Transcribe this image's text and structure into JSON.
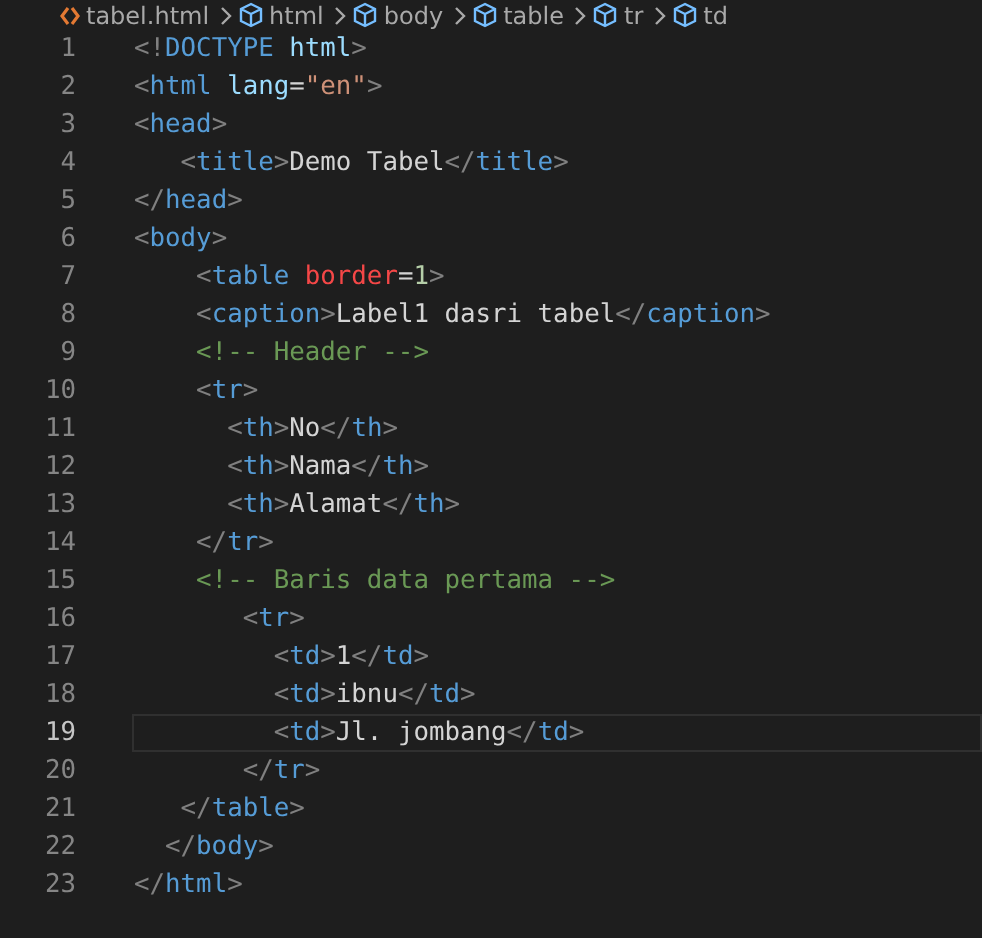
{
  "breadcrumb": [
    {
      "kind": "file",
      "label": "tabel.html"
    },
    {
      "kind": "element",
      "label": "html"
    },
    {
      "kind": "element",
      "label": "body"
    },
    {
      "kind": "element",
      "label": "table"
    },
    {
      "kind": "element",
      "label": "tr"
    },
    {
      "kind": "element",
      "label": "td"
    }
  ],
  "lines": [
    {
      "number": "1",
      "active": false,
      "tokens": [
        {
          "kind": "punct",
          "text": "<!"
        },
        {
          "kind": "tag",
          "text": "DOCTYPE"
        },
        {
          "kind": "attr",
          "text": " html"
        },
        {
          "kind": "punct",
          "text": ">"
        }
      ]
    },
    {
      "number": "2",
      "active": false,
      "tokens": [
        {
          "kind": "punct",
          "text": "<"
        },
        {
          "kind": "tag",
          "text": "html"
        },
        {
          "kind": "attr",
          "text": " lang"
        },
        {
          "kind": "text",
          "text": "="
        },
        {
          "kind": "string",
          "text": "\"en\""
        },
        {
          "kind": "punct",
          "text": ">"
        }
      ]
    },
    {
      "number": "3",
      "active": false,
      "tokens": [
        {
          "kind": "punct",
          "text": "<"
        },
        {
          "kind": "tag",
          "text": "head"
        },
        {
          "kind": "punct",
          "text": ">"
        }
      ]
    },
    {
      "number": "4",
      "active": false,
      "tokens": [
        {
          "kind": "punct",
          "text": "   <"
        },
        {
          "kind": "tag",
          "text": "title"
        },
        {
          "kind": "punct",
          "text": ">"
        },
        {
          "kind": "text",
          "text": "Demo Tabel"
        },
        {
          "kind": "punct",
          "text": "</"
        },
        {
          "kind": "tag",
          "text": "title"
        },
        {
          "kind": "punct",
          "text": ">"
        }
      ]
    },
    {
      "number": "5",
      "active": false,
      "tokens": [
        {
          "kind": "punct",
          "text": "</"
        },
        {
          "kind": "tag",
          "text": "head"
        },
        {
          "kind": "punct",
          "text": ">"
        }
      ]
    },
    {
      "number": "6",
      "active": false,
      "tokens": [
        {
          "kind": "punct",
          "text": "<"
        },
        {
          "kind": "tag",
          "text": "body"
        },
        {
          "kind": "punct",
          "text": ">"
        }
      ]
    },
    {
      "number": "7",
      "active": false,
      "tokens": [
        {
          "kind": "punct",
          "text": "    <"
        },
        {
          "kind": "tag",
          "text": "table"
        },
        {
          "kind": "error",
          "text": " border"
        },
        {
          "kind": "text",
          "text": "="
        },
        {
          "kind": "number",
          "text": "1"
        },
        {
          "kind": "punct",
          "text": ">"
        }
      ]
    },
    {
      "number": "8",
      "active": false,
      "tokens": [
        {
          "kind": "punct",
          "text": "    <"
        },
        {
          "kind": "tag",
          "text": "caption"
        },
        {
          "kind": "punct",
          "text": ">"
        },
        {
          "kind": "text",
          "text": "Label1 dasri tabel"
        },
        {
          "kind": "punct",
          "text": "</"
        },
        {
          "kind": "tag",
          "text": "caption"
        },
        {
          "kind": "punct",
          "text": ">"
        }
      ]
    },
    {
      "number": "9",
      "active": false,
      "tokens": [
        {
          "kind": "comment",
          "text": "    <!-- Header -->"
        }
      ]
    },
    {
      "number": "10",
      "active": false,
      "tokens": [
        {
          "kind": "punct",
          "text": "    <"
        },
        {
          "kind": "tag",
          "text": "tr"
        },
        {
          "kind": "punct",
          "text": ">"
        }
      ]
    },
    {
      "number": "11",
      "active": false,
      "tokens": [
        {
          "kind": "punct",
          "text": "      <"
        },
        {
          "kind": "tag",
          "text": "th"
        },
        {
          "kind": "punct",
          "text": ">"
        },
        {
          "kind": "text",
          "text": "No"
        },
        {
          "kind": "punct",
          "text": "</"
        },
        {
          "kind": "tag",
          "text": "th"
        },
        {
          "kind": "punct",
          "text": ">"
        }
      ]
    },
    {
      "number": "12",
      "active": false,
      "tokens": [
        {
          "kind": "punct",
          "text": "      <"
        },
        {
          "kind": "tag",
          "text": "th"
        },
        {
          "kind": "punct",
          "text": ">"
        },
        {
          "kind": "text",
          "text": "Nama"
        },
        {
          "kind": "punct",
          "text": "</"
        },
        {
          "kind": "tag",
          "text": "th"
        },
        {
          "kind": "punct",
          "text": ">"
        }
      ]
    },
    {
      "number": "13",
      "active": false,
      "tokens": [
        {
          "kind": "punct",
          "text": "      <"
        },
        {
          "kind": "tag",
          "text": "th"
        },
        {
          "kind": "punct",
          "text": ">"
        },
        {
          "kind": "text",
          "text": "Alamat"
        },
        {
          "kind": "punct",
          "text": "</"
        },
        {
          "kind": "tag",
          "text": "th"
        },
        {
          "kind": "punct",
          "text": ">"
        }
      ]
    },
    {
      "number": "14",
      "active": false,
      "tokens": [
        {
          "kind": "punct",
          "text": "    </"
        },
        {
          "kind": "tag",
          "text": "tr"
        },
        {
          "kind": "punct",
          "text": ">"
        }
      ]
    },
    {
      "number": "15",
      "active": false,
      "tokens": [
        {
          "kind": "comment",
          "text": "    <!-- Baris data pertama -->"
        }
      ]
    },
    {
      "number": "16",
      "active": false,
      "tokens": [
        {
          "kind": "punct",
          "text": "       <"
        },
        {
          "kind": "tag",
          "text": "tr"
        },
        {
          "kind": "punct",
          "text": ">"
        }
      ]
    },
    {
      "number": "17",
      "active": false,
      "tokens": [
        {
          "kind": "punct",
          "text": "         <"
        },
        {
          "kind": "tag",
          "text": "td"
        },
        {
          "kind": "punct",
          "text": ">"
        },
        {
          "kind": "text",
          "text": "1"
        },
        {
          "kind": "punct",
          "text": "</"
        },
        {
          "kind": "tag",
          "text": "td"
        },
        {
          "kind": "punct",
          "text": ">"
        }
      ]
    },
    {
      "number": "18",
      "active": false,
      "tokens": [
        {
          "kind": "punct",
          "text": "         <"
        },
        {
          "kind": "tag",
          "text": "td"
        },
        {
          "kind": "punct",
          "text": ">"
        },
        {
          "kind": "text",
          "text": "ibnu"
        },
        {
          "kind": "punct",
          "text": "</"
        },
        {
          "kind": "tag",
          "text": "td"
        },
        {
          "kind": "punct",
          "text": ">"
        }
      ]
    },
    {
      "number": "19",
      "active": true,
      "tokens": [
        {
          "kind": "punct",
          "text": "         <"
        },
        {
          "kind": "tag",
          "text": "td"
        },
        {
          "kind": "punct",
          "text": ">"
        },
        {
          "kind": "text",
          "text": "Jl. jombang"
        },
        {
          "kind": "punct",
          "text": "</"
        },
        {
          "kind": "tag",
          "text": "td"
        },
        {
          "kind": "punct",
          "text": ">"
        }
      ]
    },
    {
      "number": "20",
      "active": false,
      "tokens": [
        {
          "kind": "punct",
          "text": "       </"
        },
        {
          "kind": "tag",
          "text": "tr"
        },
        {
          "kind": "punct",
          "text": ">"
        }
      ]
    },
    {
      "number": "21",
      "active": false,
      "tokens": [
        {
          "kind": "punct",
          "text": "   </"
        },
        {
          "kind": "tag",
          "text": "table"
        },
        {
          "kind": "punct",
          "text": ">"
        }
      ]
    },
    {
      "number": "22",
      "active": false,
      "tokens": [
        {
          "kind": "punct",
          "text": "  </"
        },
        {
          "kind": "tag",
          "text": "body"
        },
        {
          "kind": "punct",
          "text": ">"
        }
      ]
    },
    {
      "number": "23",
      "active": false,
      "tokens": [
        {
          "kind": "punct",
          "text": "</"
        },
        {
          "kind": "tag",
          "text": "html"
        },
        {
          "kind": "punct",
          "text": ">"
        }
      ]
    }
  ]
}
